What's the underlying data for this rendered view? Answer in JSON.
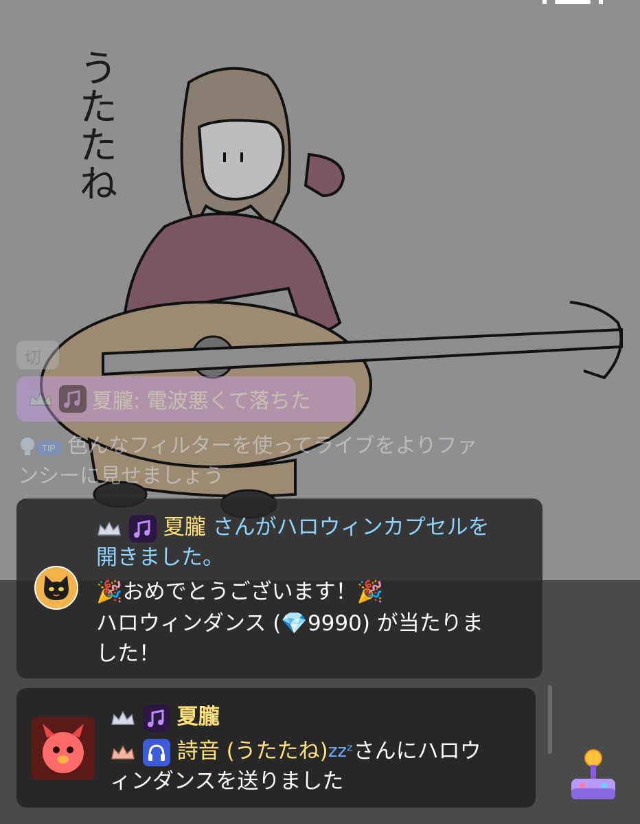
{
  "stream": {
    "handwritten_title": "うたたね"
  },
  "chat": {
    "ghost_item": "切替",
    "pinned_message": {
      "sender": "夏朧",
      "separator": ": ",
      "text": "電波悪くて落ちた"
    },
    "tip": {
      "badge": "TIP",
      "text_line1": "色んなフィルターを使ってライブをよりファ",
      "text_line2": "ンシーに見せましょう"
    }
  },
  "capsule_notice": {
    "user": "夏朧",
    "line1_rest": " さんがハロウィンカプセルを",
    "line2": "開きました。",
    "line3_emoji": "🎉",
    "line3_text": "おめでとうございます！",
    "line4_prefix": "ハロウィンダンス (",
    "line4_diamond": "💎",
    "line4_value": "9990",
    "line4_suffix": ") が当たりま",
    "line5": "した！"
  },
  "gift_notice": {
    "sender": "夏朧",
    "recipient": "詩音 (うたたね)",
    "sleep_emoji": "zzᶻ",
    "line1_rest": "さんにハロウ",
    "line2": "ィンダンスを送りました"
  },
  "colors": {
    "background": "#8f8f8f",
    "card": "#282828",
    "gold_name": "#ffe27a",
    "tip_blue": "#8fd3ff",
    "pinned_purple": "#c9a0ee",
    "badge_purple": "#7a2bd8"
  },
  "icons": [
    "crown-icon",
    "music-note-badge-icon",
    "headphones-badge-icon",
    "tip-lightbulb-icon",
    "black-cat-avatar-icon",
    "red-devil-avatar-icon",
    "joystick-icon",
    "diamond-icon"
  ]
}
